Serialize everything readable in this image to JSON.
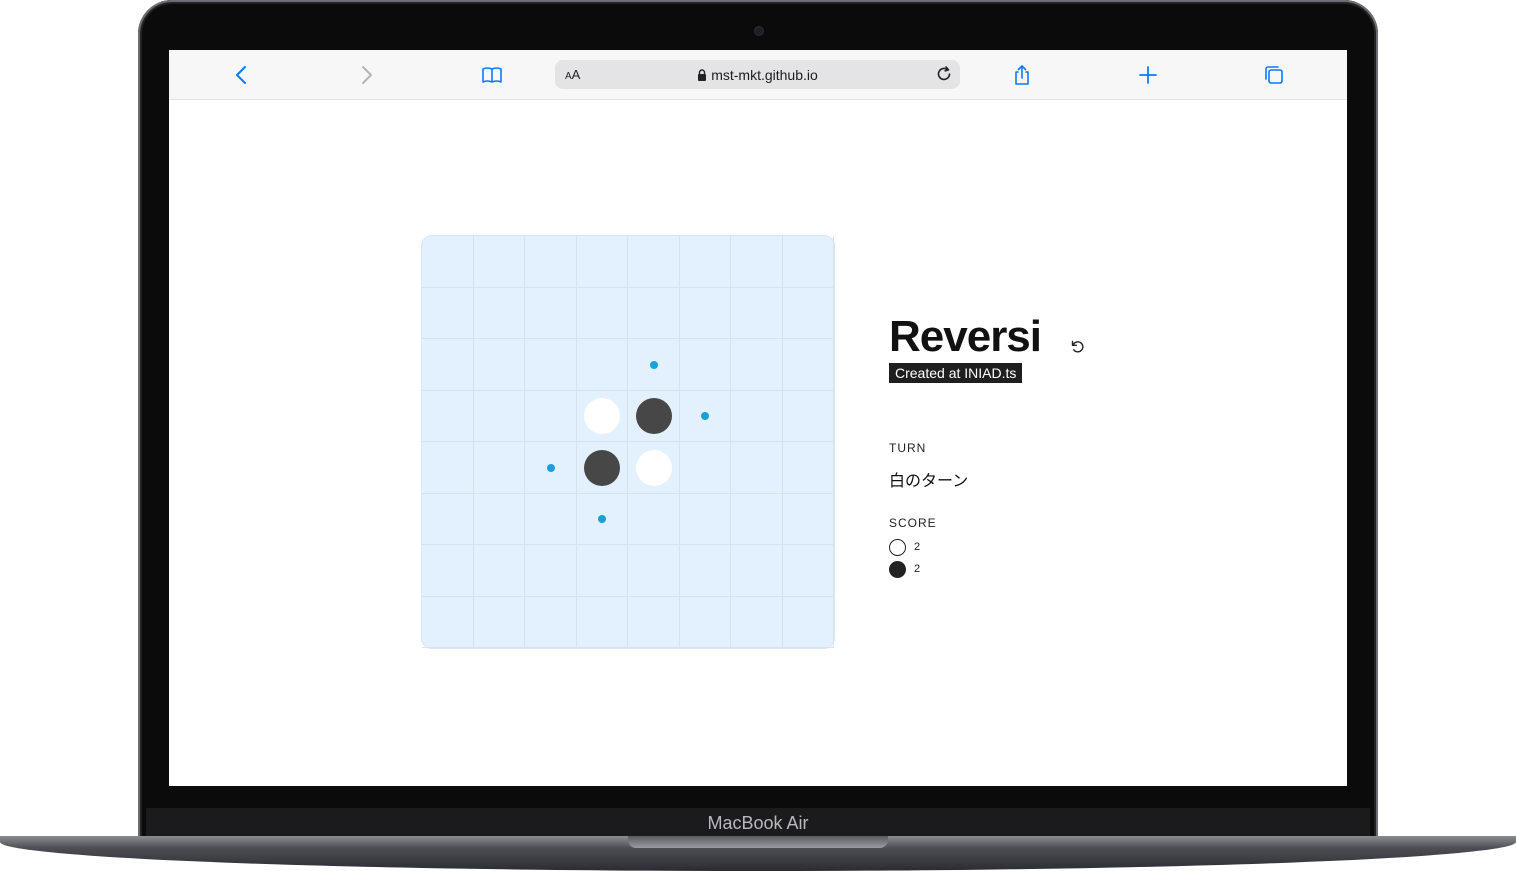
{
  "device": {
    "label": "MacBook Air"
  },
  "browser": {
    "reader_label_small": "A",
    "reader_label_large": "A",
    "url": "mst-mkt.github.io",
    "accent": "#0a7aff"
  },
  "game": {
    "title": "Reversi",
    "subtitle": "Created at INIAD.ts",
    "turn_heading": "TURN",
    "turn_text": "白のターン",
    "score_heading": "SCORE",
    "score_white": "2",
    "score_black": "2",
    "board": [
      [
        0,
        0,
        0,
        0,
        0,
        0,
        0,
        0
      ],
      [
        0,
        0,
        0,
        0,
        0,
        0,
        0,
        0
      ],
      [
        0,
        0,
        0,
        0,
        3,
        0,
        0,
        0
      ],
      [
        0,
        0,
        0,
        2,
        1,
        3,
        0,
        0
      ],
      [
        0,
        0,
        3,
        1,
        2,
        0,
        0,
        0
      ],
      [
        0,
        0,
        0,
        3,
        0,
        0,
        0,
        0
      ],
      [
        0,
        0,
        0,
        0,
        0,
        0,
        0,
        0
      ],
      [
        0,
        0,
        0,
        0,
        0,
        0,
        0,
        0
      ]
    ],
    "board_legend": {
      "0": "empty",
      "1": "black",
      "2": "white",
      "3": "valid-move"
    },
    "colors": {
      "board": "#e3f0fd",
      "black": "#474747",
      "white": "#ffffff",
      "hint": "#1aa0d8"
    }
  }
}
